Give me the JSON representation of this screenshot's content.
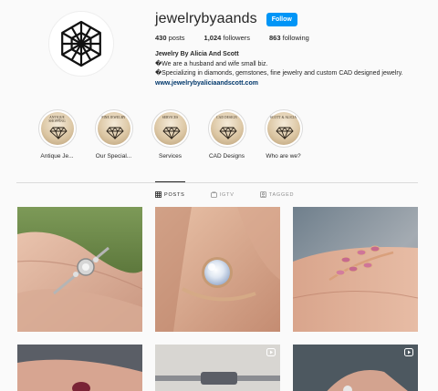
{
  "profile": {
    "username": "jewelrybyaands",
    "follow_label": "Follow",
    "posts_count": "430",
    "posts_label": "posts",
    "followers_count": "1,024",
    "followers_label": "followers",
    "following_count": "863",
    "following_label": "following",
    "full_name": "Jewelry By Alicia And Scott",
    "bio_line1": "�We are a husband and wife small biz.",
    "bio_line2": "�Specializing in diamonds, gemstones, fine jewelry and custom CAD designed jewelry.",
    "website": "www.jewelrybyaliciaandscott.com"
  },
  "highlights": [
    {
      "cover_text": "ANTIQUE SHOPPING",
      "label": "Antique Je..."
    },
    {
      "cover_text": "FINE JEWELRY",
      "label": "Our Special..."
    },
    {
      "cover_text": "SERVICES",
      "label": "Services"
    },
    {
      "cover_text": "CAD DESIGN",
      "label": "CAD Designs"
    },
    {
      "cover_text": "SCOTT & ALICIA",
      "label": "Who are we?"
    }
  ],
  "tabs": {
    "posts": "POSTS",
    "igtv": "IGTV",
    "tagged": "TAGGED"
  },
  "colors": {
    "follow_button": "#0095f6",
    "link": "#00376b",
    "background": "#fafafa"
  },
  "icons": {
    "posts_tab": "grid-icon",
    "igtv_tab": "tv-icon",
    "tagged_tab": "tag-icon",
    "video_badge": "video-icon"
  }
}
